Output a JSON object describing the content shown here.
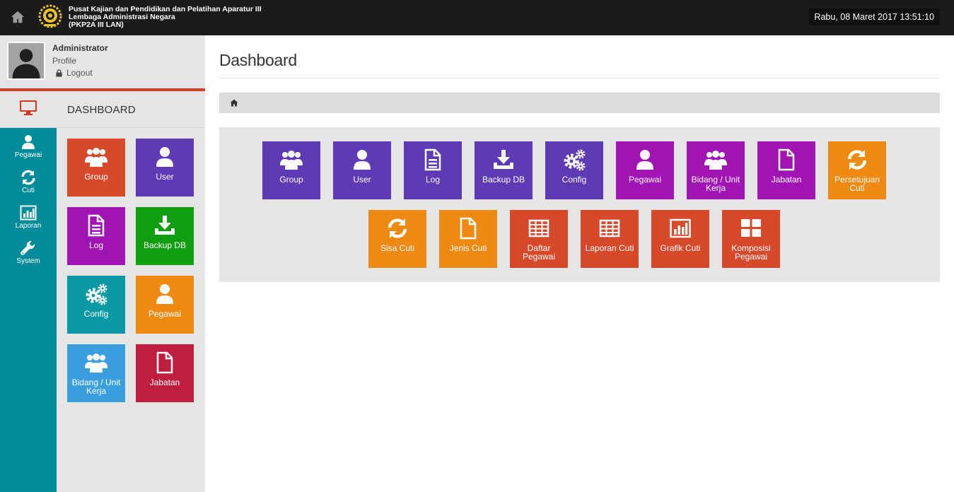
{
  "header": {
    "org_line1": "Pusat Kajian dan Pendidikan dan Pelatihan Aparatur III",
    "org_line2": "Lembaga Administrasi Negara",
    "org_line3": "(PKP2A III LAN)",
    "datetime": "Rabu, 08 Maret 2017  13:51:10"
  },
  "user": {
    "name": "Administrator",
    "profile_label": "Profile",
    "logout_label": "Logout"
  },
  "sidebar": {
    "dashboard_label": "DASHBOARD",
    "rail": [
      {
        "label": "Pegawai",
        "icon": "user-icon"
      },
      {
        "label": "Cuti",
        "icon": "refresh-icon"
      },
      {
        "label": "Laporan",
        "icon": "bar-chart-icon"
      },
      {
        "label": "System",
        "icon": "wrench-icon"
      }
    ],
    "tiles": [
      {
        "label": "Group",
        "icon": "users-icon",
        "color": "#d6492a"
      },
      {
        "label": "User",
        "icon": "user-icon",
        "color": "#5e3bb5"
      },
      {
        "label": "Log",
        "icon": "document-icon",
        "color": "#a114b4"
      },
      {
        "label": "Backup DB",
        "icon": "download-icon",
        "color": "#0f9e0f"
      },
      {
        "label": "Config",
        "icon": "gears-icon",
        "color": "#0b99a6"
      },
      {
        "label": "Pegawai",
        "icon": "user-icon",
        "color": "#ee8a12"
      },
      {
        "label": "Bidang / Unit Kerja",
        "icon": "users-icon",
        "color": "#3a9fdf"
      },
      {
        "label": "Jabatan",
        "icon": "file-icon",
        "color": "#be1e3f"
      }
    ]
  },
  "main": {
    "title": "Dashboard",
    "tiles_row1": [
      {
        "label": "Group",
        "icon": "users-icon",
        "color": "#5e3bb5"
      },
      {
        "label": "User",
        "icon": "user-icon",
        "color": "#5e3bb5"
      },
      {
        "label": "Log",
        "icon": "document-icon",
        "color": "#5e3bb5"
      },
      {
        "label": "Backup DB",
        "icon": "download-icon",
        "color": "#5e3bb5"
      },
      {
        "label": "Config",
        "icon": "gears-icon",
        "color": "#5e3bb5"
      },
      {
        "label": "Pegawai",
        "icon": "user-icon",
        "color": "#a114b4"
      },
      {
        "label": "Bidang / Unit Kerja",
        "icon": "users-icon",
        "color": "#a114b4"
      },
      {
        "label": "Jabatan",
        "icon": "file-icon",
        "color": "#a114b4"
      },
      {
        "label": "Persetujuan Cuti",
        "icon": "refresh-icon",
        "color": "#ee8a12"
      }
    ],
    "tiles_row2": [
      {
        "label": "Sisa Cuti",
        "icon": "refresh-icon",
        "color": "#ee8a12"
      },
      {
        "label": "Jenis Cuti",
        "icon": "file-icon",
        "color": "#ee8a12"
      },
      {
        "label": "Daftar Pegawai",
        "icon": "table-icon",
        "color": "#d6492a"
      },
      {
        "label": "Laporan Cuti",
        "icon": "table-icon",
        "color": "#d6492a"
      },
      {
        "label": "Grafik Cuti",
        "icon": "bar-chart-icon",
        "color": "#d6492a"
      },
      {
        "label": "Komposisi Pegawai",
        "icon": "grid-icon",
        "color": "#d6492a"
      }
    ]
  }
}
